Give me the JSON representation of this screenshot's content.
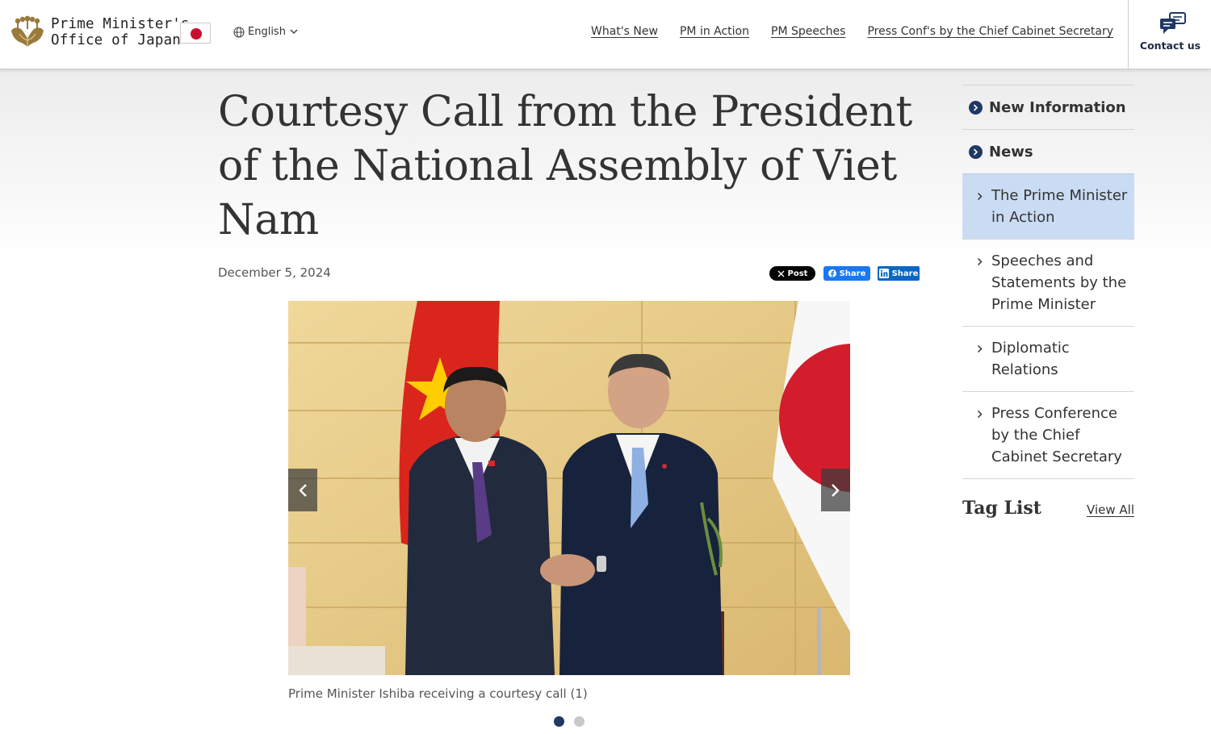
{
  "header": {
    "site_name_line1": "Prime Minister's",
    "site_name_line2": "Office of Japan",
    "language": "English",
    "nav": [
      "What's New",
      "PM in Action",
      "PM Speeches",
      "Press Conf's by the Chief Cabinet Secretary"
    ],
    "contact": "Contact us"
  },
  "article": {
    "title": "Courtesy Call from the President of the National Assembly of Viet Nam",
    "date": "December 5, 2024",
    "share": {
      "x": "Post",
      "facebook": "Share",
      "linkedin": "Share"
    },
    "caption": "Prime Minister Ishiba receiving a courtesy call (1)",
    "slides_total": 2,
    "slide_active": 1
  },
  "sidebar": {
    "heads": [
      "New Information",
      "News"
    ],
    "items": [
      {
        "label": "The Prime Minister in Action",
        "active": true
      },
      {
        "label": "Speeches and Statements by the Prime Minister",
        "active": false
      },
      {
        "label": "Diplomatic Relations",
        "active": false
      },
      {
        "label": "Press Conference by the Chief Cabinet Secretary",
        "active": false
      }
    ],
    "tag_list": "Tag List",
    "view_all": "View All"
  },
  "colors": {
    "accent": "#1f3864",
    "active_bg": "#cadcf3",
    "japan_red": "#c8102e",
    "vietnam_red": "#da251d",
    "vietnam_star": "#ffcd00"
  }
}
